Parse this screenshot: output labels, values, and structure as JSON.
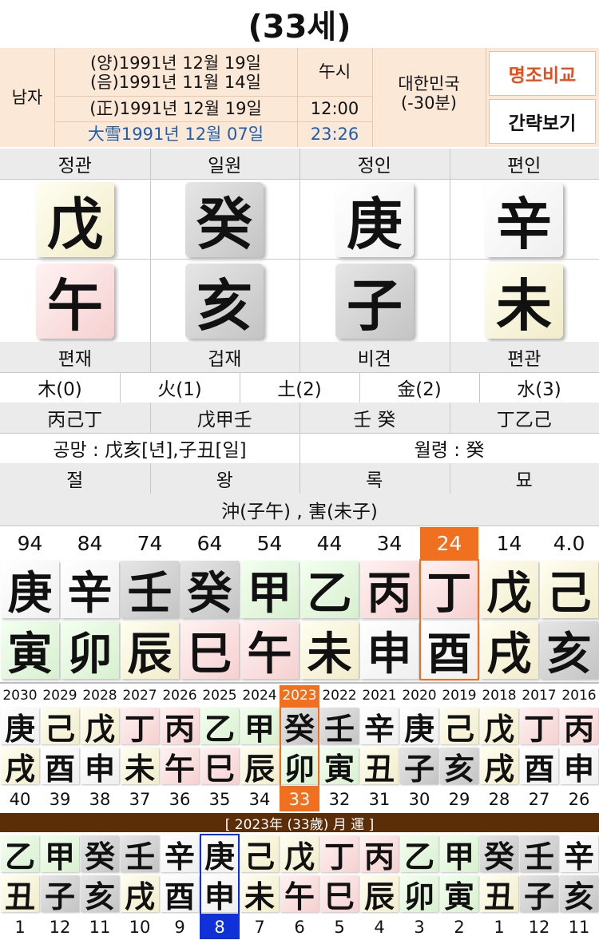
{
  "title": "(33세)",
  "info": {
    "gender": "남자",
    "solar_date": "(양)1991년 12월 19일",
    "lunar_date": "(음)1991년 11월 14일",
    "correct_date": "(正)1991년 12월 19일",
    "term_date": "大雪1991년 12월 07일",
    "hour_name": "午시",
    "time": "12:00",
    "term_time": "23:26",
    "country": "대한민국",
    "offset": "(-30분)",
    "compare_button": "명조비교",
    "simple_button": "간략보기",
    "compare_color": "#e84e1b",
    "term_color": "#1a5fb4"
  },
  "top_labels": [
    "정관",
    "일원",
    "정인",
    "편인"
  ],
  "stems": [
    {
      "char": "戊",
      "tone": "yellow"
    },
    {
      "char": "癸",
      "tone": "gray"
    },
    {
      "char": "庚",
      "tone": "white"
    },
    {
      "char": "辛",
      "tone": "white"
    }
  ],
  "branches": [
    {
      "char": "午",
      "tone": "red"
    },
    {
      "char": "亥",
      "tone": "gray"
    },
    {
      "char": "子",
      "tone": "gray"
    },
    {
      "char": "未",
      "tone": "yellow"
    }
  ],
  "bottom_labels": [
    "편재",
    "겁재",
    "비견",
    "편관"
  ],
  "elements": [
    "木(0)",
    "火(1)",
    "土(2)",
    "金(2)",
    "水(3)"
  ],
  "hidden_stems": [
    "丙己丁",
    "戊甲壬",
    "壬 癸",
    "丁乙己"
  ],
  "gongmang": "공망 : 戊亥[년],子丑[일]",
  "wolryeong": "월령 : 癸",
  "stages": [
    "절",
    "왕",
    "록",
    "묘"
  ],
  "relations": "沖(子午) , 害(未子)",
  "daeun": {
    "ages": [
      "94",
      "84",
      "74",
      "64",
      "54",
      "44",
      "34",
      "24",
      "14",
      "4.0"
    ],
    "active_index": 7,
    "stems": [
      {
        "char": "庚",
        "tone": "white"
      },
      {
        "char": "辛",
        "tone": "white"
      },
      {
        "char": "壬",
        "tone": "gray"
      },
      {
        "char": "癸",
        "tone": "gray"
      },
      {
        "char": "甲",
        "tone": "green"
      },
      {
        "char": "乙",
        "tone": "green"
      },
      {
        "char": "丙",
        "tone": "red"
      },
      {
        "char": "丁",
        "tone": "red"
      },
      {
        "char": "戊",
        "tone": "yellow"
      },
      {
        "char": "己",
        "tone": "yellow"
      }
    ],
    "branches": [
      {
        "char": "寅",
        "tone": "green"
      },
      {
        "char": "卯",
        "tone": "green"
      },
      {
        "char": "辰",
        "tone": "yellow"
      },
      {
        "char": "巳",
        "tone": "red"
      },
      {
        "char": "午",
        "tone": "red"
      },
      {
        "char": "未",
        "tone": "yellow"
      },
      {
        "char": "申",
        "tone": "white"
      },
      {
        "char": "酉",
        "tone": "white"
      },
      {
        "char": "戌",
        "tone": "yellow"
      },
      {
        "char": "亥",
        "tone": "gray"
      }
    ]
  },
  "seun": {
    "years": [
      "2030",
      "2029",
      "2028",
      "2027",
      "2026",
      "2025",
      "2024",
      "2023",
      "2022",
      "2021",
      "2020",
      "2019",
      "2018",
      "2017",
      "2016"
    ],
    "stems": [
      {
        "char": "庚",
        "tone": "white"
      },
      {
        "char": "己",
        "tone": "yellow"
      },
      {
        "char": "戊",
        "tone": "yellow"
      },
      {
        "char": "丁",
        "tone": "red"
      },
      {
        "char": "丙",
        "tone": "red"
      },
      {
        "char": "乙",
        "tone": "green"
      },
      {
        "char": "甲",
        "tone": "green"
      },
      {
        "char": "癸",
        "tone": "gray"
      },
      {
        "char": "壬",
        "tone": "gray"
      },
      {
        "char": "辛",
        "tone": "white"
      },
      {
        "char": "庚",
        "tone": "white"
      },
      {
        "char": "己",
        "tone": "yellow"
      },
      {
        "char": "戊",
        "tone": "yellow"
      },
      {
        "char": "丁",
        "tone": "red"
      },
      {
        "char": "丙",
        "tone": "red"
      }
    ],
    "branches": [
      {
        "char": "戌",
        "tone": "yellow"
      },
      {
        "char": "酉",
        "tone": "white"
      },
      {
        "char": "申",
        "tone": "white"
      },
      {
        "char": "未",
        "tone": "yellow"
      },
      {
        "char": "午",
        "tone": "red"
      },
      {
        "char": "巳",
        "tone": "red"
      },
      {
        "char": "辰",
        "tone": "yellow"
      },
      {
        "char": "卯",
        "tone": "green"
      },
      {
        "char": "寅",
        "tone": "green"
      },
      {
        "char": "丑",
        "tone": "yellow"
      },
      {
        "char": "子",
        "tone": "gray"
      },
      {
        "char": "亥",
        "tone": "gray"
      },
      {
        "char": "戌",
        "tone": "yellow"
      },
      {
        "char": "酉",
        "tone": "white"
      },
      {
        "char": "申",
        "tone": "white"
      }
    ],
    "ages": [
      "40",
      "39",
      "38",
      "37",
      "36",
      "35",
      "34",
      "33",
      "32",
      "31",
      "30",
      "29",
      "28",
      "27",
      "26"
    ],
    "active_index": 7
  },
  "month_bar": "[ 2023年 (33歲) 月 運 ]",
  "wolun": {
    "stems": [
      {
        "char": "乙",
        "tone": "green"
      },
      {
        "char": "甲",
        "tone": "green"
      },
      {
        "char": "癸",
        "tone": "gray"
      },
      {
        "char": "壬",
        "tone": "gray"
      },
      {
        "char": "辛",
        "tone": "white"
      },
      {
        "char": "庚",
        "tone": "white"
      },
      {
        "char": "己",
        "tone": "yellow"
      },
      {
        "char": "戊",
        "tone": "yellow"
      },
      {
        "char": "丁",
        "tone": "red"
      },
      {
        "char": "丙",
        "tone": "red"
      },
      {
        "char": "乙",
        "tone": "green"
      },
      {
        "char": "甲",
        "tone": "green"
      },
      {
        "char": "癸",
        "tone": "gray"
      },
      {
        "char": "壬",
        "tone": "gray"
      },
      {
        "char": "辛",
        "tone": "white"
      }
    ],
    "branches": [
      {
        "char": "丑",
        "tone": "yellow"
      },
      {
        "char": "子",
        "tone": "gray"
      },
      {
        "char": "亥",
        "tone": "gray"
      },
      {
        "char": "戌",
        "tone": "yellow"
      },
      {
        "char": "酉",
        "tone": "white"
      },
      {
        "char": "申",
        "tone": "white"
      },
      {
        "char": "未",
        "tone": "yellow"
      },
      {
        "char": "午",
        "tone": "red"
      },
      {
        "char": "巳",
        "tone": "red"
      },
      {
        "char": "辰",
        "tone": "yellow"
      },
      {
        "char": "卯",
        "tone": "green"
      },
      {
        "char": "寅",
        "tone": "green"
      },
      {
        "char": "丑",
        "tone": "yellow"
      },
      {
        "char": "子",
        "tone": "gray"
      },
      {
        "char": "亥",
        "tone": "gray"
      }
    ],
    "months": [
      "1",
      "12",
      "11",
      "10",
      "9",
      "8",
      "7",
      "6",
      "5",
      "4",
      "3",
      "2",
      "1",
      "12",
      "11"
    ],
    "active_index": 5
  }
}
